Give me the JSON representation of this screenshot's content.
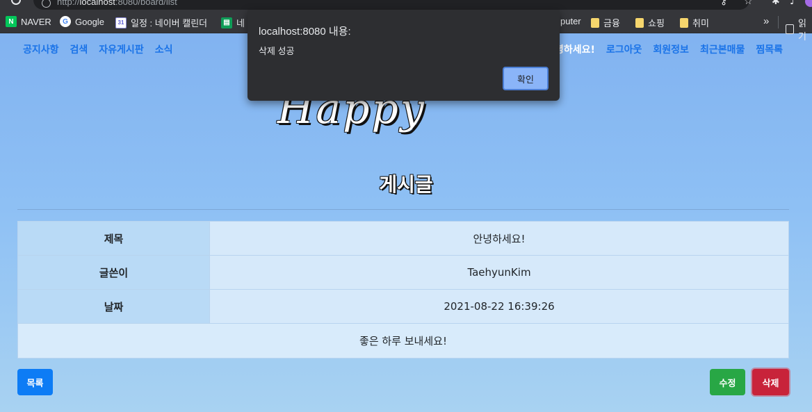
{
  "browser": {
    "url_prefix": "http://",
    "url_host": "localhost",
    "url_rest": ":8080/board/list",
    "bookmarks": [
      {
        "label": "NAVER",
        "icon": "naver-icon"
      },
      {
        "label": "Google",
        "icon": "google-icon"
      },
      {
        "label": "일정 : 네이버 캘린더",
        "icon": "calendar-icon"
      },
      {
        "label": "네",
        "icon": "sheet-icon"
      },
      {
        "label": "puter",
        "icon": "folder-icon"
      },
      {
        "label": "금융",
        "icon": "folder-icon"
      },
      {
        "label": "쇼핑",
        "icon": "folder-icon"
      },
      {
        "label": "취미",
        "icon": "folder-icon"
      }
    ],
    "more_label": "»",
    "reading_list_label": "읽기"
  },
  "nav": {
    "left": [
      "공지사항",
      "검색",
      "자유게시판",
      "소식"
    ],
    "greeting": "안녕하세요!",
    "right": [
      "로그아웃",
      "회원정보",
      "최근본매물",
      "찜목록"
    ]
  },
  "logo": "Happy House",
  "page_title": "게시글",
  "post": {
    "rows": [
      {
        "label": "제목",
        "value": "안녕하세요!"
      },
      {
        "label": "글쓴이",
        "value": "TaehyunKim"
      },
      {
        "label": "날짜",
        "value": "2021-08-22 16:39:26"
      }
    ],
    "content": "좋은 하루 보내세요!"
  },
  "buttons": {
    "list": "목록",
    "edit": "수정",
    "delete": "삭제"
  },
  "alert": {
    "title": "localhost:8080 내용:",
    "message": "삭제 성공",
    "ok": "확인"
  },
  "colors": {
    "list_button": "#0d7cf5",
    "edit_button": "#28a745",
    "delete_button": "#c8233a",
    "nav_link": "#1a73e8"
  }
}
